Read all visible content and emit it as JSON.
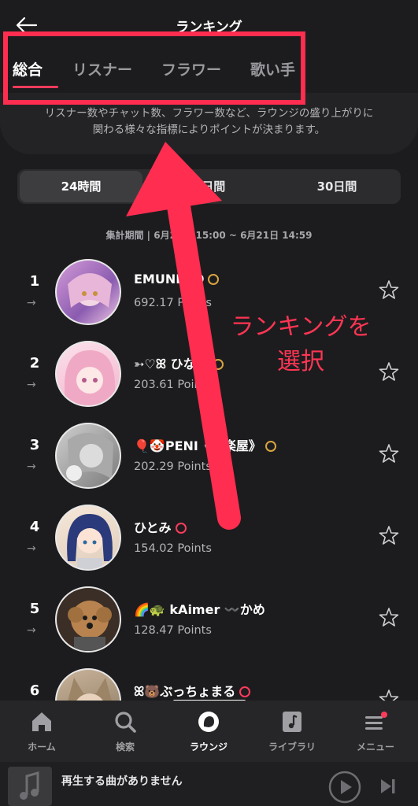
{
  "header": {
    "title": "ランキング"
  },
  "tabs": [
    "総合",
    "リスナー",
    "フラワー",
    "歌い手"
  ],
  "description": {
    "line1": "リスナー数やチャット数、フラワー数など、ラウンジの盛り上がりに",
    "line2": "関わる様々な指標によりポイントが決まります。"
  },
  "periods": [
    "24時間",
    "7日間",
    "30日間"
  ],
  "range_text": "集計期間 | 6月20日 15:00 ~ 6月21日 14:59",
  "ranking": [
    {
      "rank": "1",
      "name": "EMUNEKO",
      "points": "692.17 Points",
      "badge_color": "#d9a441"
    },
    {
      "rank": "2",
      "name": "➳♡ꕤ ひなた",
      "points": "203.61 Points",
      "badge_color": "#d9a441"
    },
    {
      "rank": "3",
      "name": "🎈🤡PENI《朗楽屋》",
      "points": "202.29 Points",
      "badge_color": "#d9a441"
    },
    {
      "rank": "4",
      "name": "ひとみ",
      "points": "154.02 Points",
      "badge_color": "#ff3b5c"
    },
    {
      "rank": "5",
      "name": "🌈🐢 kAimer 〰️かめ",
      "points": "128.47 Points",
      "badge_color": ""
    },
    {
      "rank": "6",
      "name": "ꕤ🐻ぶっちょまる",
      "points": "",
      "badge_color": "#ff3b5c"
    }
  ],
  "trend_symbol": "→",
  "annotation": {
    "line1": "ランキングを",
    "line2": "選択"
  },
  "bottom_nav": [
    {
      "label": "ホーム",
      "icon": "home-icon"
    },
    {
      "label": "検索",
      "icon": "search-icon"
    },
    {
      "label": "ラウンジ",
      "icon": "lounge-icon"
    },
    {
      "label": "ライブラリ",
      "icon": "library-icon"
    },
    {
      "label": "メニュー",
      "icon": "menu-icon"
    }
  ],
  "player": {
    "text": "再生する曲がありません"
  },
  "colors": {
    "accent": "#ff3b5c",
    "background": "#1c1c1e",
    "annotation": "#ff2d4f"
  }
}
